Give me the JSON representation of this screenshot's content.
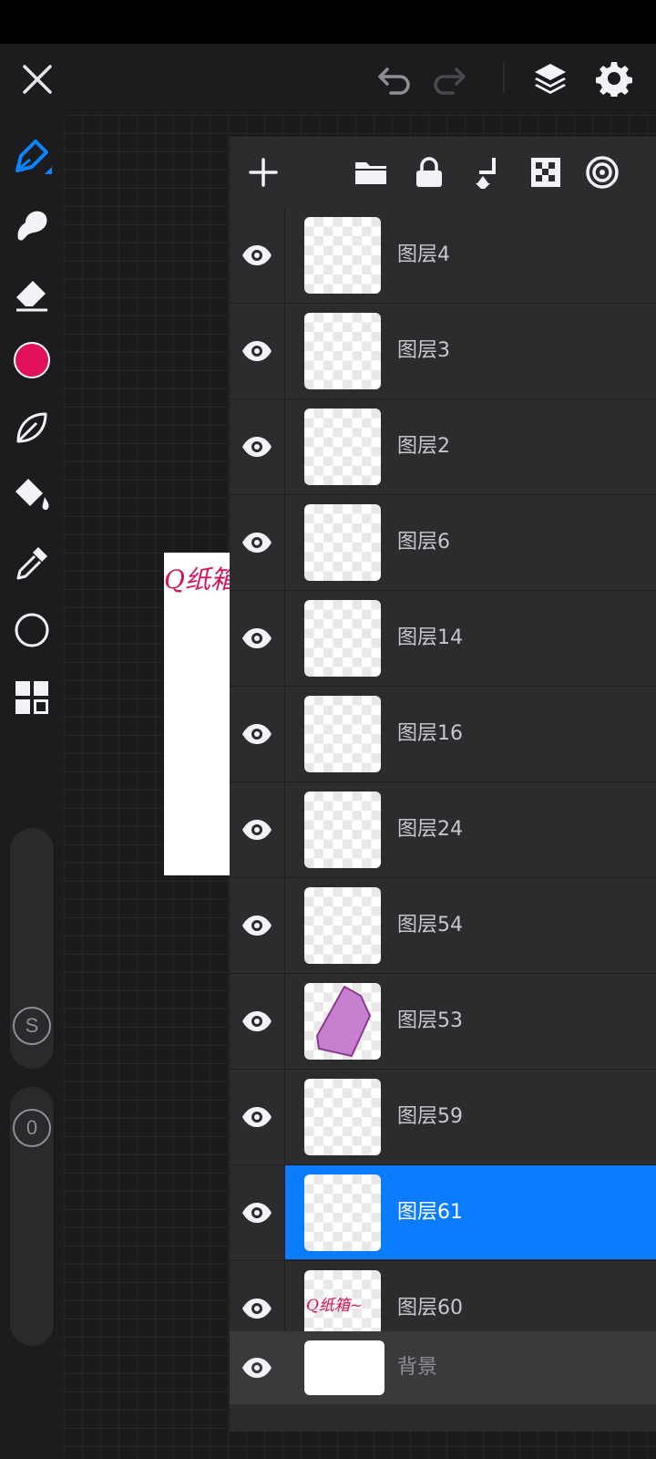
{
  "topbar": {
    "close_icon": "close-icon",
    "undo_icon": "undo-icon",
    "redo_icon": "redo-icon",
    "layers_icon": "layers-icon",
    "settings_icon": "gear-icon"
  },
  "tools": {
    "items": [
      "pen-tool",
      "smudge-tool",
      "eraser-tool",
      "color-swatch",
      "lasso-tool",
      "fill-bucket-tool",
      "eyedropper-tool",
      "shape-tool",
      "more-tools"
    ],
    "active_color": "#e0105c",
    "accent": "#0a84ff"
  },
  "sliders": {
    "size_label": "S",
    "opacity_label": "0"
  },
  "canvas": {
    "art_text": "Q纸箱~"
  },
  "layers_panel": {
    "toolbar_icons": [
      "add-layer-icon",
      "folder-icon",
      "lock-icon",
      "merge-down-icon",
      "transparency-icon",
      "blend-mode-icon"
    ],
    "layers": [
      {
        "name": "图层4",
        "thumb": "empty",
        "selected": false
      },
      {
        "name": "图层3",
        "thumb": "empty",
        "selected": false
      },
      {
        "name": "图层2",
        "thumb": "empty",
        "selected": false
      },
      {
        "name": "图层6",
        "thumb": "empty",
        "selected": false
      },
      {
        "name": "图层14",
        "thumb": "empty",
        "selected": false
      },
      {
        "name": "图层16",
        "thumb": "empty",
        "selected": false
      },
      {
        "name": "图层24",
        "thumb": "empty",
        "selected": false
      },
      {
        "name": "图层54",
        "thumb": "empty",
        "selected": false
      },
      {
        "name": "图层53",
        "thumb": "shape",
        "selected": false
      },
      {
        "name": "图层59",
        "thumb": "empty",
        "selected": false
      },
      {
        "name": "图层61",
        "thumb": "empty",
        "selected": true
      },
      {
        "name": "图层60",
        "thumb": "text",
        "selected": false
      }
    ],
    "thumb_text": "Q纸箱~",
    "background_layer": "背景",
    "selected_color": "#0a7cff",
    "shape_fill": "#c97fcf"
  }
}
